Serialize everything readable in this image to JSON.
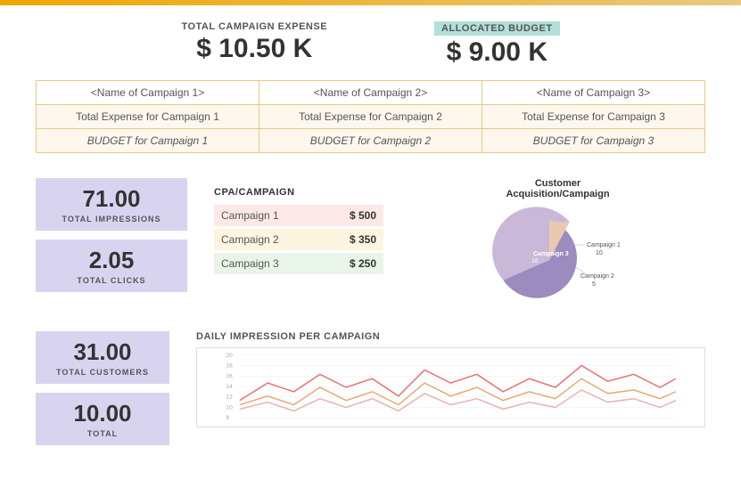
{
  "topbar": {},
  "summary": {
    "total_expense_label": "TOTAL CAMPAIGN EXPENSE",
    "total_expense_value": "$ 10.50 K",
    "allocated_budget_label": "ALLOCATED BUDGET",
    "allocated_budget_value": "$ 9.00 K"
  },
  "campaign_table": {
    "headers": [
      "<Name of Campaign 1>",
      "<Name of Campaign 2>",
      "<Name of Campaign 3>"
    ],
    "row1": [
      "Total Expense for Campaign 1",
      "Total Expense for Campaign 2",
      "Total Expense for Campaign 3"
    ],
    "row2": [
      "BUDGET for Campaign 1",
      "BUDGET for Campaign 2",
      "BUDGET for Campaign 3"
    ]
  },
  "metrics": {
    "impressions_value": "71.00",
    "impressions_label": "TOTAL IMPRESSIONS",
    "clicks_value": "2.05",
    "clicks_label": "TOTAL CLICKS",
    "customers_value": "31.00",
    "customers_label": "TOTAL CUSTOMERS",
    "fourth_value": "10.00",
    "fourth_label": "TOTAL ?"
  },
  "cpa": {
    "title": "CPA/CAMPAIGN",
    "rows": [
      {
        "label": "Campaign 1",
        "value": "$ 500"
      },
      {
        "label": "Campaign 2",
        "value": "$ 350"
      },
      {
        "label": "Campaign 3",
        "value": "$ 250"
      }
    ]
  },
  "pie_chart": {
    "title": "Customer\nAcquisition/Campaign",
    "segments": [
      {
        "label": "Campaign 1",
        "value": 10,
        "color": "#c9b8d8"
      },
      {
        "label": "Campaign 2",
        "value": 5,
        "color": "#e8c9b0"
      },
      {
        "label": "Campaign 3",
        "value": 16,
        "color": "#9b8bbf"
      }
    ]
  },
  "daily_chart": {
    "title": "DAILY IMPRESSION PER CAMPAIGN",
    "y_max": 20,
    "y_labels": [
      "20",
      "18",
      "16",
      "14",
      "12",
      "10",
      "8"
    ]
  }
}
